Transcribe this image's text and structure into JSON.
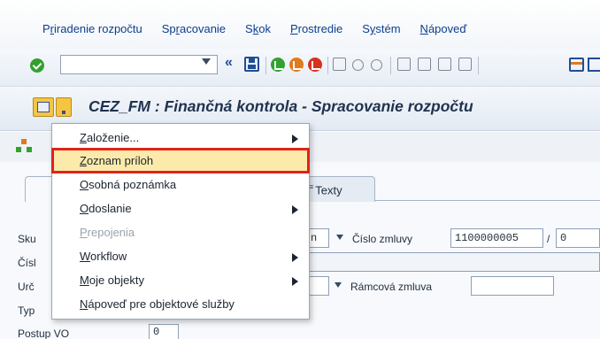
{
  "menubar": {
    "items": [
      {
        "pre": "P",
        "u": "r",
        "post": "iradenie rozpočtu"
      },
      {
        "pre": "Sp",
        "u": "r",
        "post": "acovanie"
      },
      {
        "pre": "S",
        "u": "k",
        "post": "ok"
      },
      {
        "pre": "",
        "u": "P",
        "post": "rostredie"
      },
      {
        "pre": "S",
        "u": "y",
        "post": "stém"
      },
      {
        "pre": "",
        "u": "N",
        "post": "ápoveď"
      }
    ]
  },
  "toolbar": {
    "command_value": "",
    "back_glyph": "«",
    "icons": [
      "check-icon",
      "save-icon",
      "back-nav-icon",
      "exit-nav-icon",
      "cancel-nav-icon",
      "print-icon",
      "find-icon",
      "find-next-icon",
      "first-page-icon",
      "prev-page-icon",
      "next-page-icon",
      "last-page-icon",
      "layout-icon"
    ],
    "colors": {
      "green": "#33a12f",
      "orange": "#e07a1f",
      "red": "#d6321e",
      "blue": "#1f4e94"
    }
  },
  "title": "CEZ_FM : Finančná kontrola - Spracovanie rozpočtu",
  "tabs": [
    {
      "label": "Texty"
    }
  ],
  "form": {
    "labels": {
      "sku": "Sku",
      "cisl": "Čísl",
      "urc": "Urč",
      "typ": "Typ",
      "postup": "Postup VO"
    },
    "cislo_zmluvy_label": "Číslo zmluvy",
    "cislo_zmluvy_value": "1100000005",
    "slash": "/",
    "cislo_zmluvy_pos": "0",
    "ramcova_zmluva_label": "Rámcová zmluva",
    "ramcova_zmluva_value": "",
    "sku_field_tail": "n",
    "postup_value": "0"
  },
  "popup_menu": {
    "items": [
      {
        "pre": "",
        "u": "Z",
        "post": "aloženie...",
        "submenu": true,
        "enabled": true,
        "selected": false
      },
      {
        "pre": "",
        "u": "Z",
        "post": "oznam príloh",
        "submenu": false,
        "enabled": true,
        "selected": true
      },
      {
        "pre": "",
        "u": "O",
        "post": "sobná poznámka",
        "submenu": false,
        "enabled": true,
        "selected": false
      },
      {
        "pre": "",
        "u": "O",
        "post": "doslanie",
        "submenu": true,
        "enabled": true,
        "selected": false
      },
      {
        "pre": "",
        "u": "P",
        "post": "repojenia",
        "submenu": false,
        "enabled": false,
        "selected": false
      },
      {
        "pre": "",
        "u": "W",
        "post": "orkflow",
        "submenu": true,
        "enabled": true,
        "selected": false
      },
      {
        "pre": "",
        "u": "M",
        "post": "oje objekty",
        "submenu": true,
        "enabled": true,
        "selected": false
      },
      {
        "pre": "",
        "u": "N",
        "post": "ápoveď pre objektové služby",
        "submenu": false,
        "enabled": true,
        "selected": false
      }
    ],
    "highlight_color": "#e0231c",
    "selected_bg": "#fbeaa9"
  }
}
